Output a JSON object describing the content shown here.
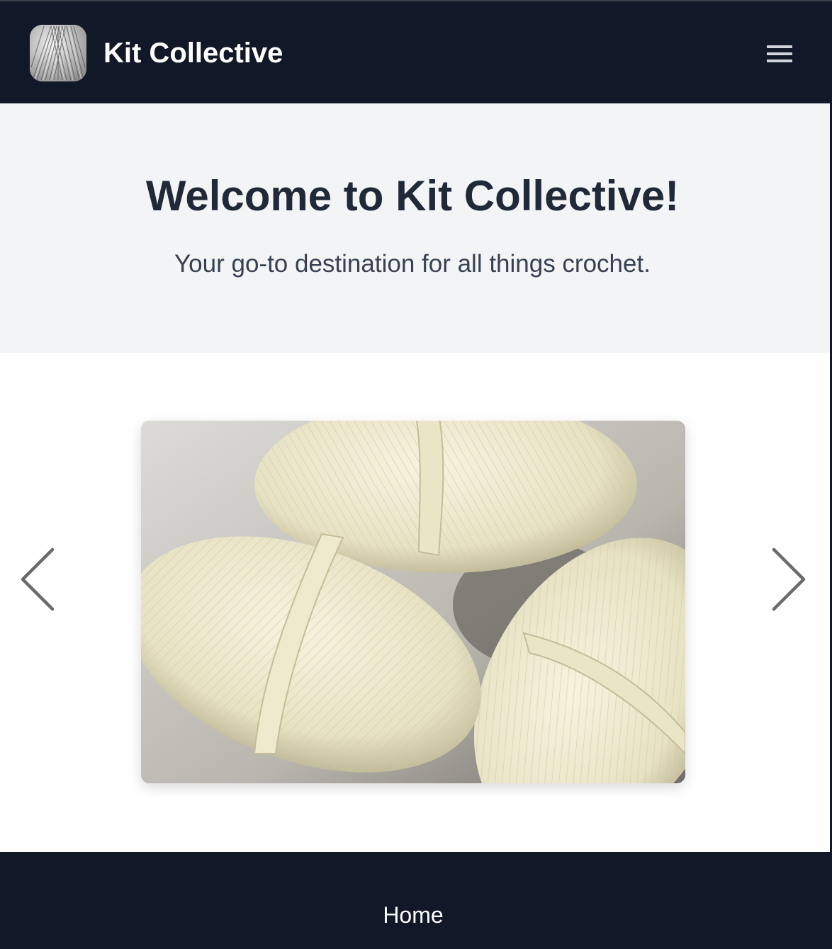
{
  "header": {
    "brand_name": "Kit Collective",
    "logo_icon": "yarn-ball-logo",
    "menu_icon": "hamburger-menu-icon"
  },
  "hero": {
    "title": "Welcome to Kit Collective!",
    "subtitle": "Your go-to destination for all things crochet."
  },
  "carousel": {
    "prev_icon": "chevron-left-icon",
    "next_icon": "chevron-right-icon",
    "slide_image": "three-cream-yarn-skeins"
  },
  "footer": {
    "link_home": "Home"
  },
  "colors": {
    "header_bg": "#111827",
    "hero_bg": "#f3f4f6",
    "title_text": "#1f2937",
    "subtitle_text": "#374151",
    "arrow": "#6b6b6b"
  }
}
